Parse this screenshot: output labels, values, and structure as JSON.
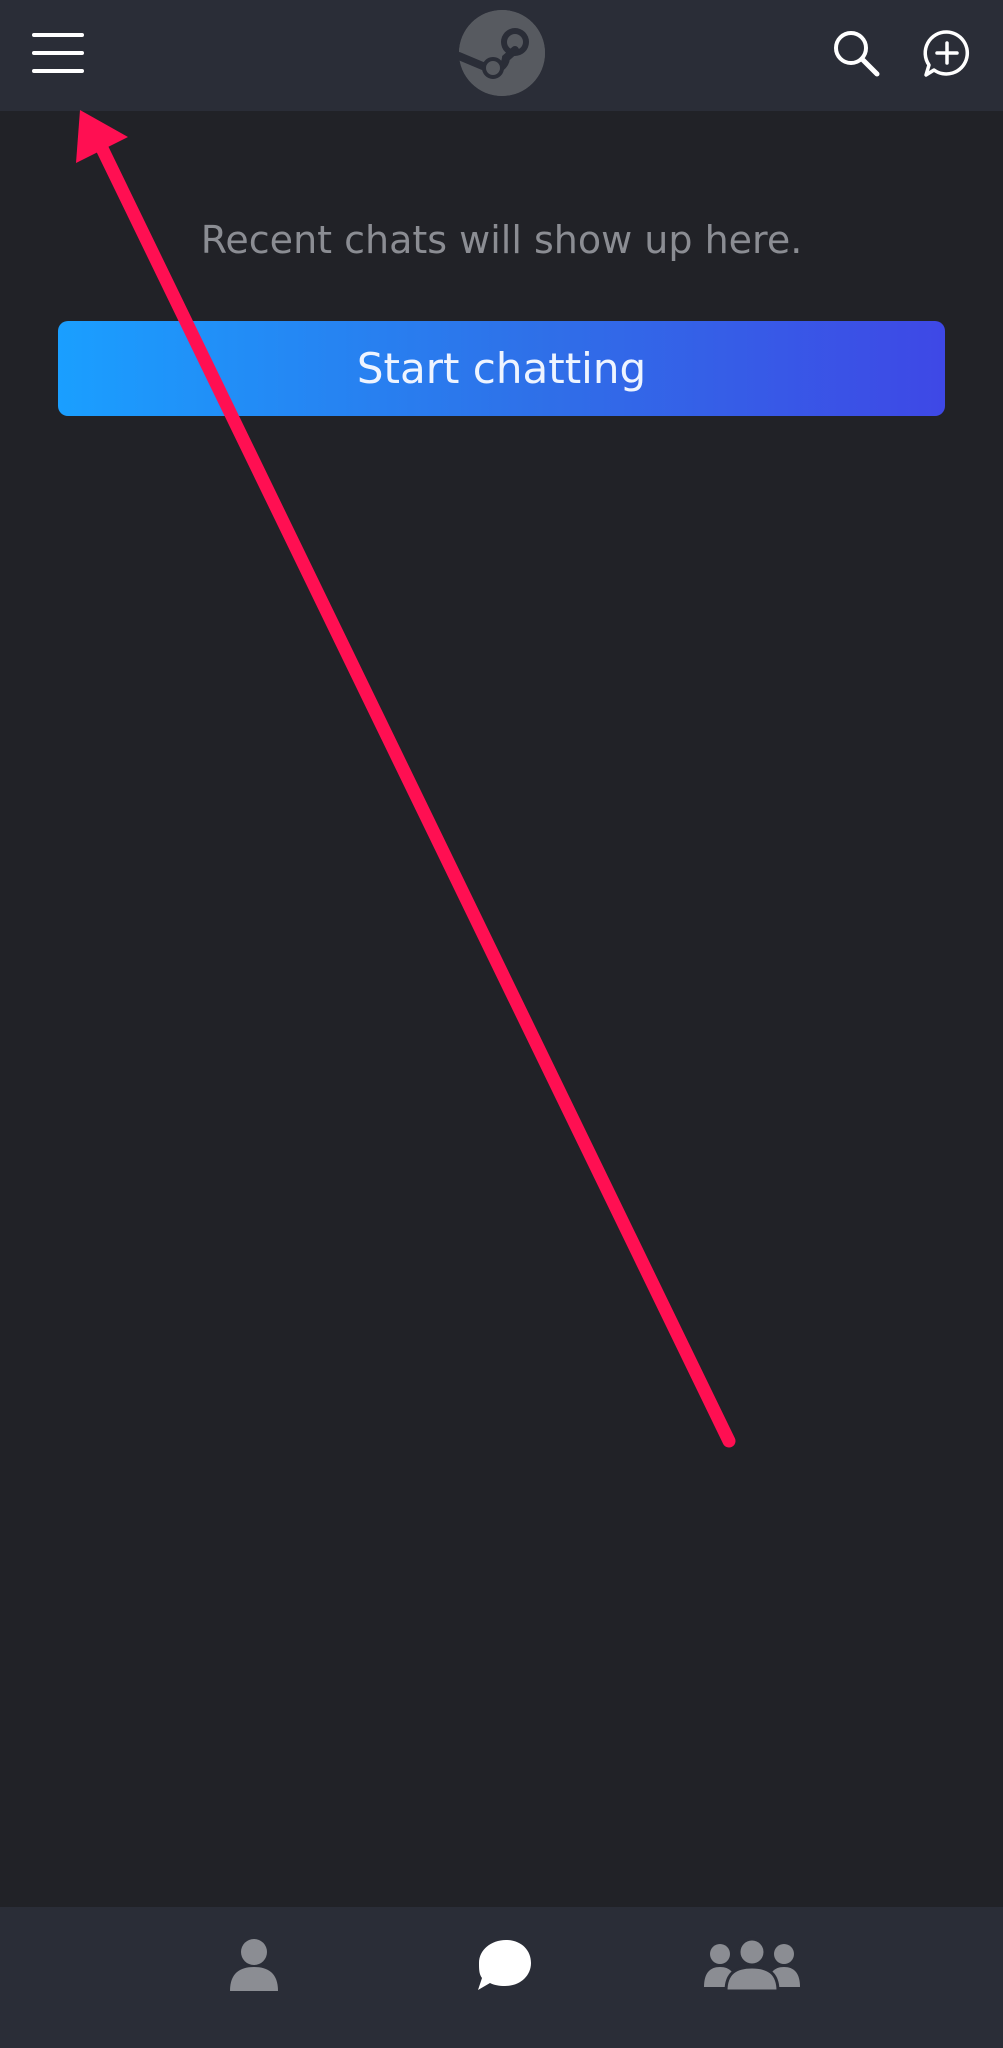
{
  "header": {
    "menu_icon": "hamburger-menu-icon",
    "logo_icon": "steam-logo-icon",
    "search_icon": "search-icon",
    "new_chat_icon": "new-chat-plus-icon"
  },
  "main": {
    "empty_message": "Recent chats will show up here.",
    "start_button_label": "Start chatting"
  },
  "bottom_nav": {
    "items": [
      {
        "icon": "profile-icon",
        "active": false
      },
      {
        "icon": "chat-bubble-icon",
        "active": true
      },
      {
        "icon": "groups-icon",
        "active": false
      }
    ]
  },
  "colors": {
    "background": "#212227",
    "bar_background": "#2a2d37",
    "button_gradient_start": "#1a9fff",
    "button_gradient_end": "#3e48e6",
    "annotation_arrow": "#ff0f52",
    "inactive_icon": "#8b8d93",
    "active_icon": "#ffffff"
  }
}
